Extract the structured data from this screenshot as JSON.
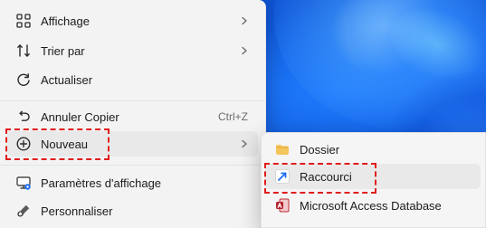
{
  "menu": {
    "items": [
      {
        "label": "Affichage",
        "icon": "view-grid-icon",
        "has_submenu": true
      },
      {
        "label": "Trier par",
        "icon": "sort-arrows-icon",
        "has_submenu": true
      },
      {
        "label": "Actualiser",
        "icon": "refresh-icon",
        "has_submenu": false
      },
      {
        "label": "Annuler Copier",
        "icon": "undo-icon",
        "accelerator": "Ctrl+Z",
        "has_submenu": false
      },
      {
        "label": "Nouveau",
        "icon": "add-circle-icon",
        "has_submenu": true,
        "highlighted": true
      },
      {
        "label": "Paramètres d'affichage",
        "icon": "display-settings-icon",
        "has_submenu": false
      },
      {
        "label": "Personnaliser",
        "icon": "personalize-brush-icon",
        "has_submenu": false
      }
    ]
  },
  "submenu": {
    "items": [
      {
        "label": "Dossier",
        "icon": "folder-icon"
      },
      {
        "label": "Raccourci",
        "icon": "shortcut-arrow-icon",
        "highlighted": true
      },
      {
        "label": "Microsoft Access Database",
        "icon": "access-db-icon"
      }
    ]
  },
  "colors": {
    "annotation": "#e11d1d",
    "menu_bg": "#f3f3f3",
    "hover_bg": "#e9e9e9",
    "wallpaper": "#0f56d8"
  }
}
